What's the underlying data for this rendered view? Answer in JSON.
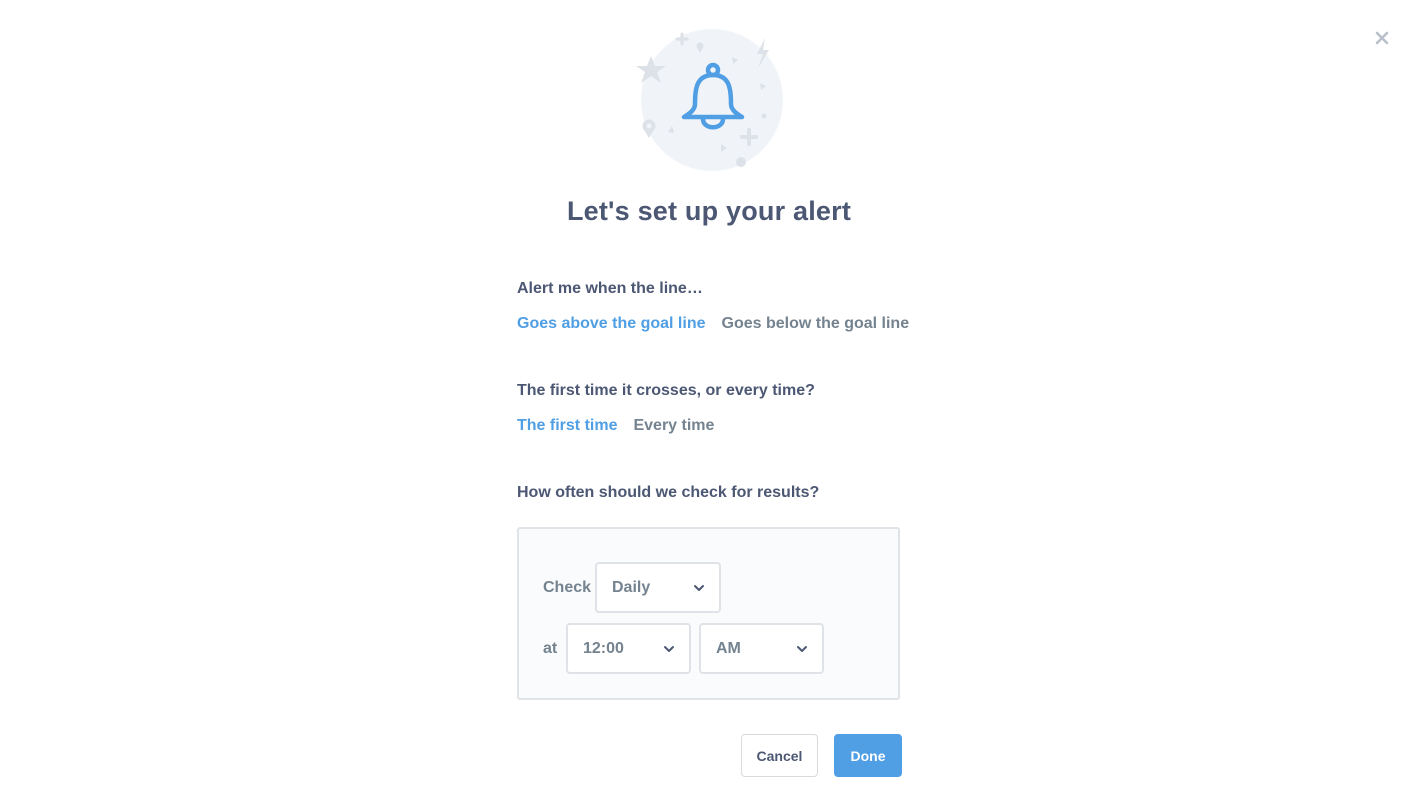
{
  "dialog": {
    "title": "Let's set up your alert",
    "close_icon": "close-icon",
    "hero_icon": "bell-icon"
  },
  "sections": {
    "direction": {
      "label": "Alert me when the line…",
      "options": [
        "Goes above the goal line",
        "Goes below the goal line"
      ],
      "selected": "Goes above the goal line"
    },
    "frequency": {
      "label": "The first time it crosses, or every time?",
      "options": [
        "The first time",
        "Every time"
      ],
      "selected": "The first time"
    },
    "schedule": {
      "label": "How often should we check for results?",
      "check_label": "Check",
      "check_value": "Daily",
      "at_label": "at",
      "time_value": "12:00",
      "ampm_value": "AM"
    }
  },
  "footer": {
    "cancel_label": "Cancel",
    "done_label": "Done"
  },
  "colors": {
    "accent": "#509ee3",
    "text": "#4c5773",
    "muted": "#74838f"
  }
}
